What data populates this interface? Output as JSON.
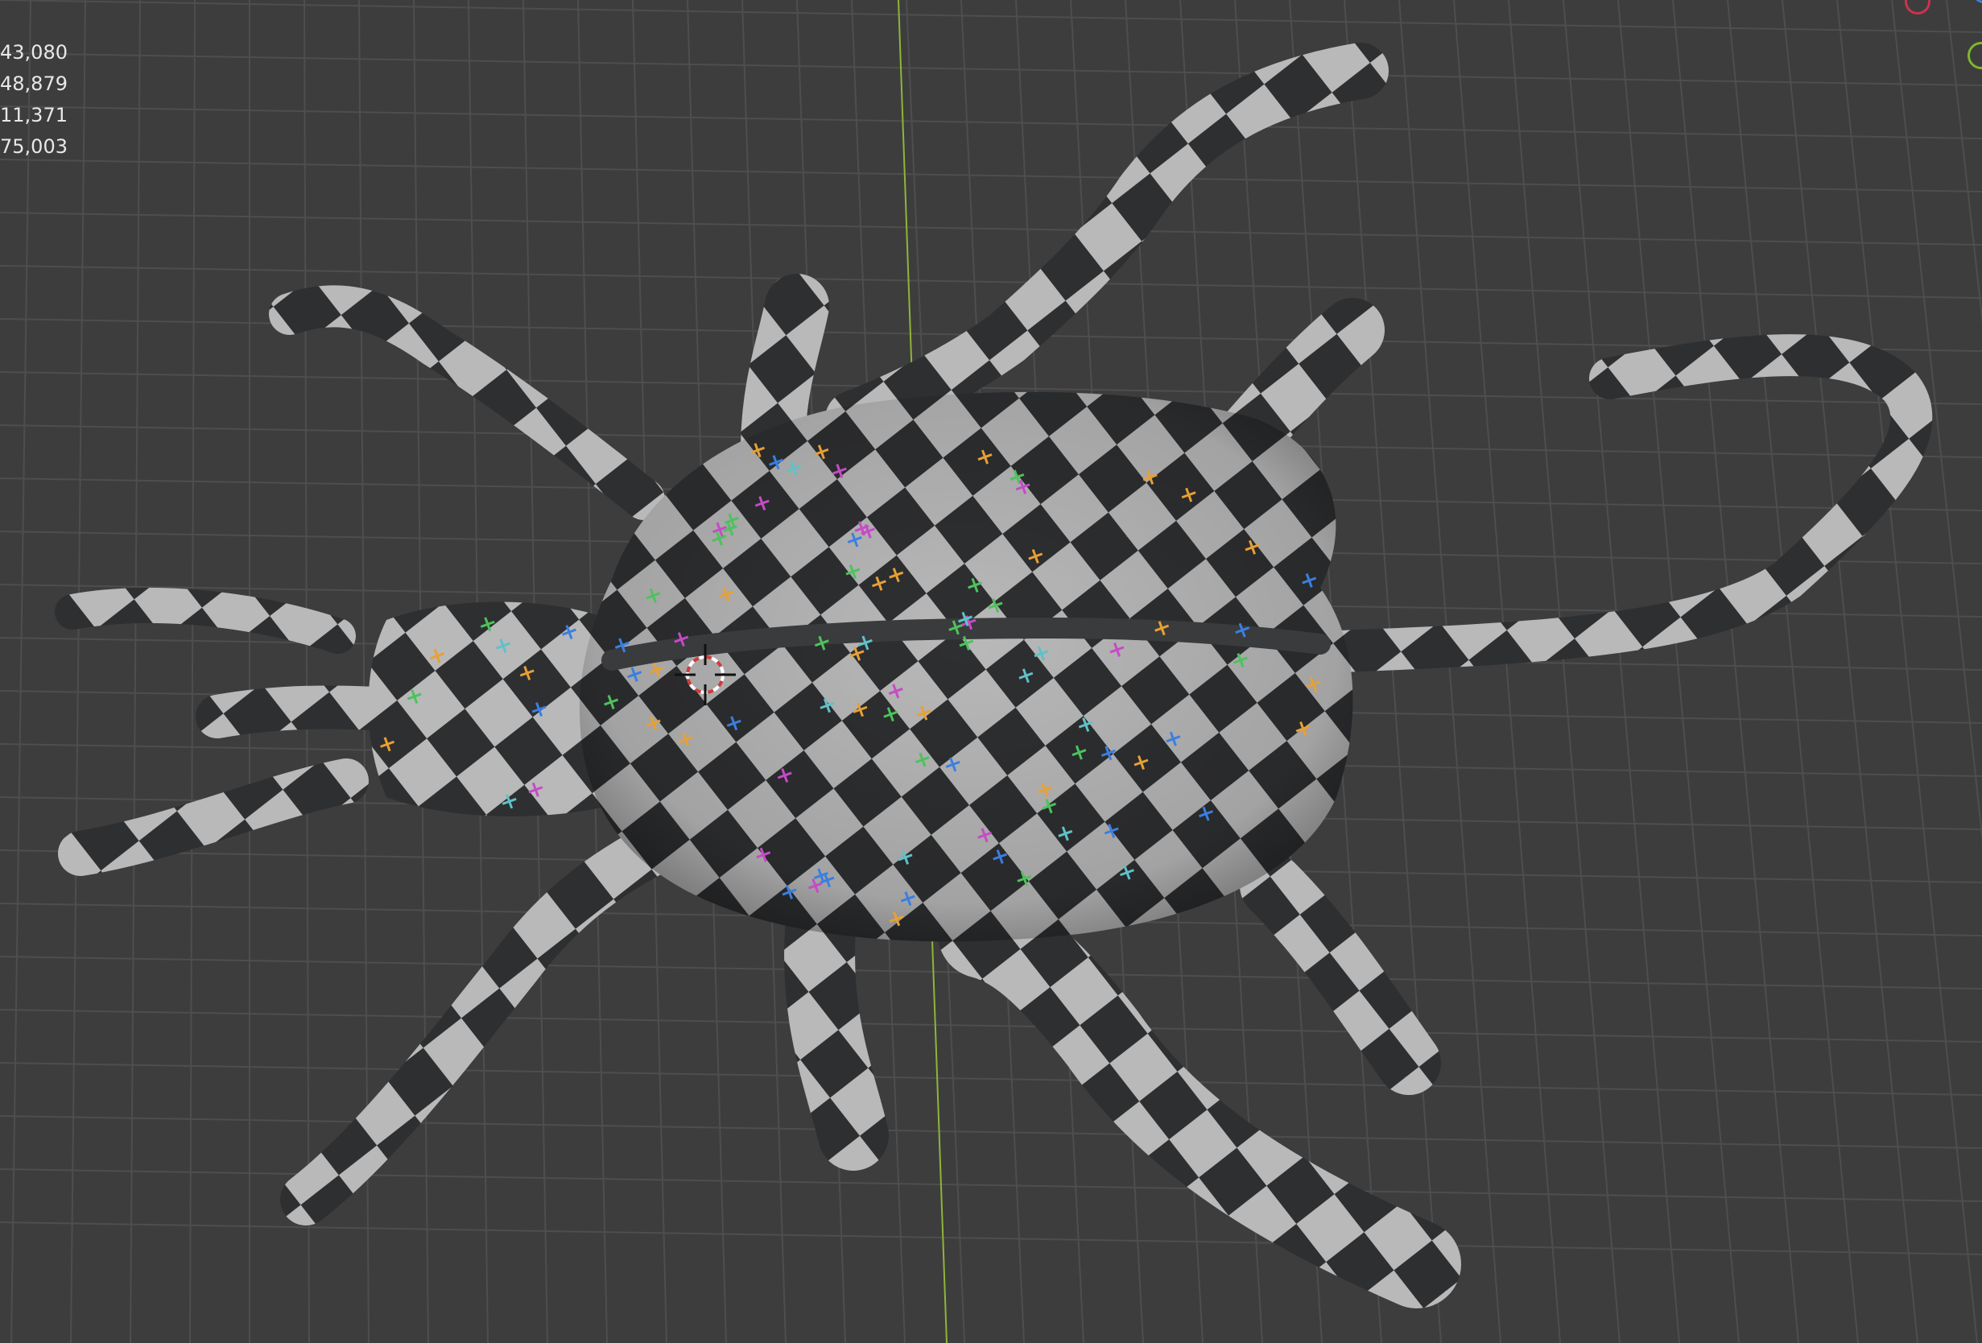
{
  "viewport": {
    "background": "#3d3d3d",
    "grid_color": "#4e4e4e",
    "y_axis_color": "#8fb43a",
    "stats": [
      "43,080",
      "48,879",
      "11,371",
      "75,003"
    ]
  },
  "model": {
    "checker_light": "#b9b9b9",
    "checker_dark": "#2e2f31",
    "uv_marker_colors": [
      "#e8a034",
      "#4dc25d",
      "#3a7fe0",
      "#c64ac8",
      "#5ec2c9"
    ]
  },
  "gizmo": {
    "x_color": "#c7344e",
    "y_color": "#7fb530",
    "z_color": "#3f7fd6"
  }
}
